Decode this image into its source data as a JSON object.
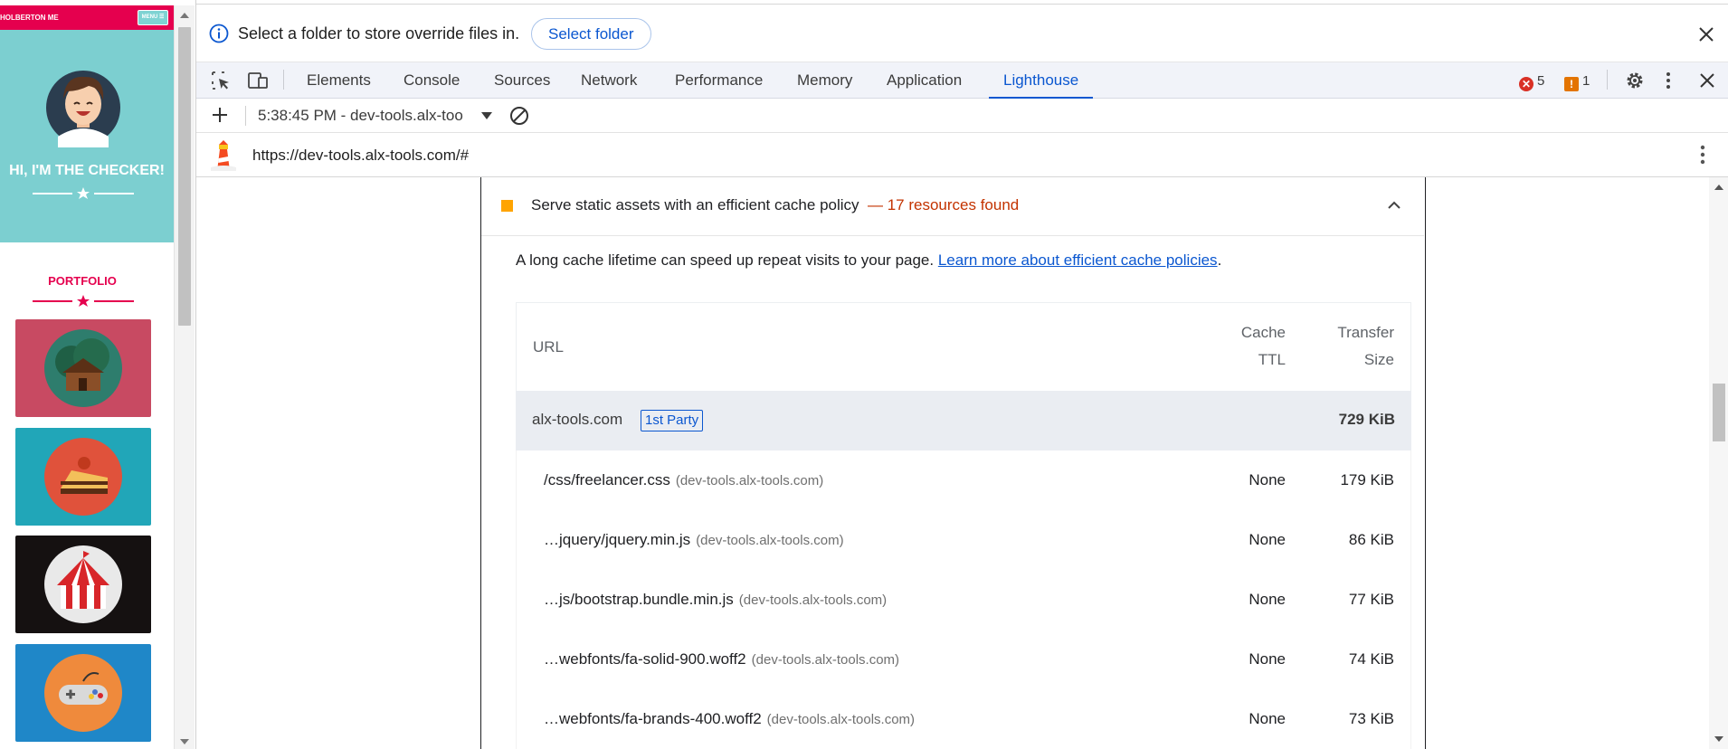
{
  "site": {
    "brand": "HOLBERTON ME",
    "menu_label": "MENU ☰",
    "hero_title": "HI, I'M THE CHECKER!",
    "portfolio_title": "PORTFOLIO",
    "colors": {
      "primary": "#e5004e",
      "hero": "#7ccfd0"
    },
    "tiles": [
      {
        "icon": "cabin-icon",
        "bg": "#c84a62"
      },
      {
        "icon": "cake-icon",
        "bg": "#21a6b8"
      },
      {
        "icon": "circus-tent-icon",
        "bg": "#151111"
      },
      {
        "icon": "game-controller-icon",
        "bg": "#1f87c8"
      }
    ]
  },
  "infobar": {
    "message": "Select a folder to store override files in.",
    "button_label": "Select folder"
  },
  "tabs": [
    {
      "label": "Elements",
      "active": false
    },
    {
      "label": "Console",
      "active": false
    },
    {
      "label": "Sources",
      "active": false
    },
    {
      "label": "Network",
      "active": false
    },
    {
      "label": "Performance",
      "active": false
    },
    {
      "label": "Memory",
      "active": false
    },
    {
      "label": "Application",
      "active": false
    },
    {
      "label": "Lighthouse",
      "active": true
    }
  ],
  "status": {
    "errors": "5",
    "warnings": "1"
  },
  "subbar": {
    "report_selector": "5:38:45 PM - dev-tools.alx-too"
  },
  "urlbar": {
    "url": "https://dev-tools.alx-tools.com/#"
  },
  "audit": {
    "title": "Serve static assets with an efficient cache policy",
    "found": "— 17 resources found",
    "description": "A long cache lifetime can speed up repeat visits to your page. ",
    "link_text": "Learn more about efficient cache policies",
    "description_end": ".",
    "table": {
      "headers": {
        "url": "URL",
        "cache_ttl_1": "Cache",
        "cache_ttl_2": "TTL",
        "size_1": "Transfer",
        "size_2": "Size"
      },
      "group": {
        "host": "alx-tools.com",
        "tag": "1st Party",
        "total": "729 KiB"
      },
      "rows": [
        {
          "path": "/css/freelancer.css",
          "host": "(dev-tools.alx-tools.com)",
          "ttl": "None",
          "size": "179 KiB"
        },
        {
          "path": "…jquery/jquery.min.js",
          "host": "(dev-tools.alx-tools.com)",
          "ttl": "None",
          "size": "86 KiB"
        },
        {
          "path": "…js/bootstrap.bundle.min.js",
          "host": "(dev-tools.alx-tools.com)",
          "ttl": "None",
          "size": "77 KiB"
        },
        {
          "path": "…webfonts/fa-solid-900.woff2",
          "host": "(dev-tools.alx-tools.com)",
          "ttl": "None",
          "size": "74 KiB"
        },
        {
          "path": "…webfonts/fa-brands-400.woff2",
          "host": "(dev-tools.alx-tools.com)",
          "ttl": "None",
          "size": "73 KiB"
        }
      ]
    }
  }
}
